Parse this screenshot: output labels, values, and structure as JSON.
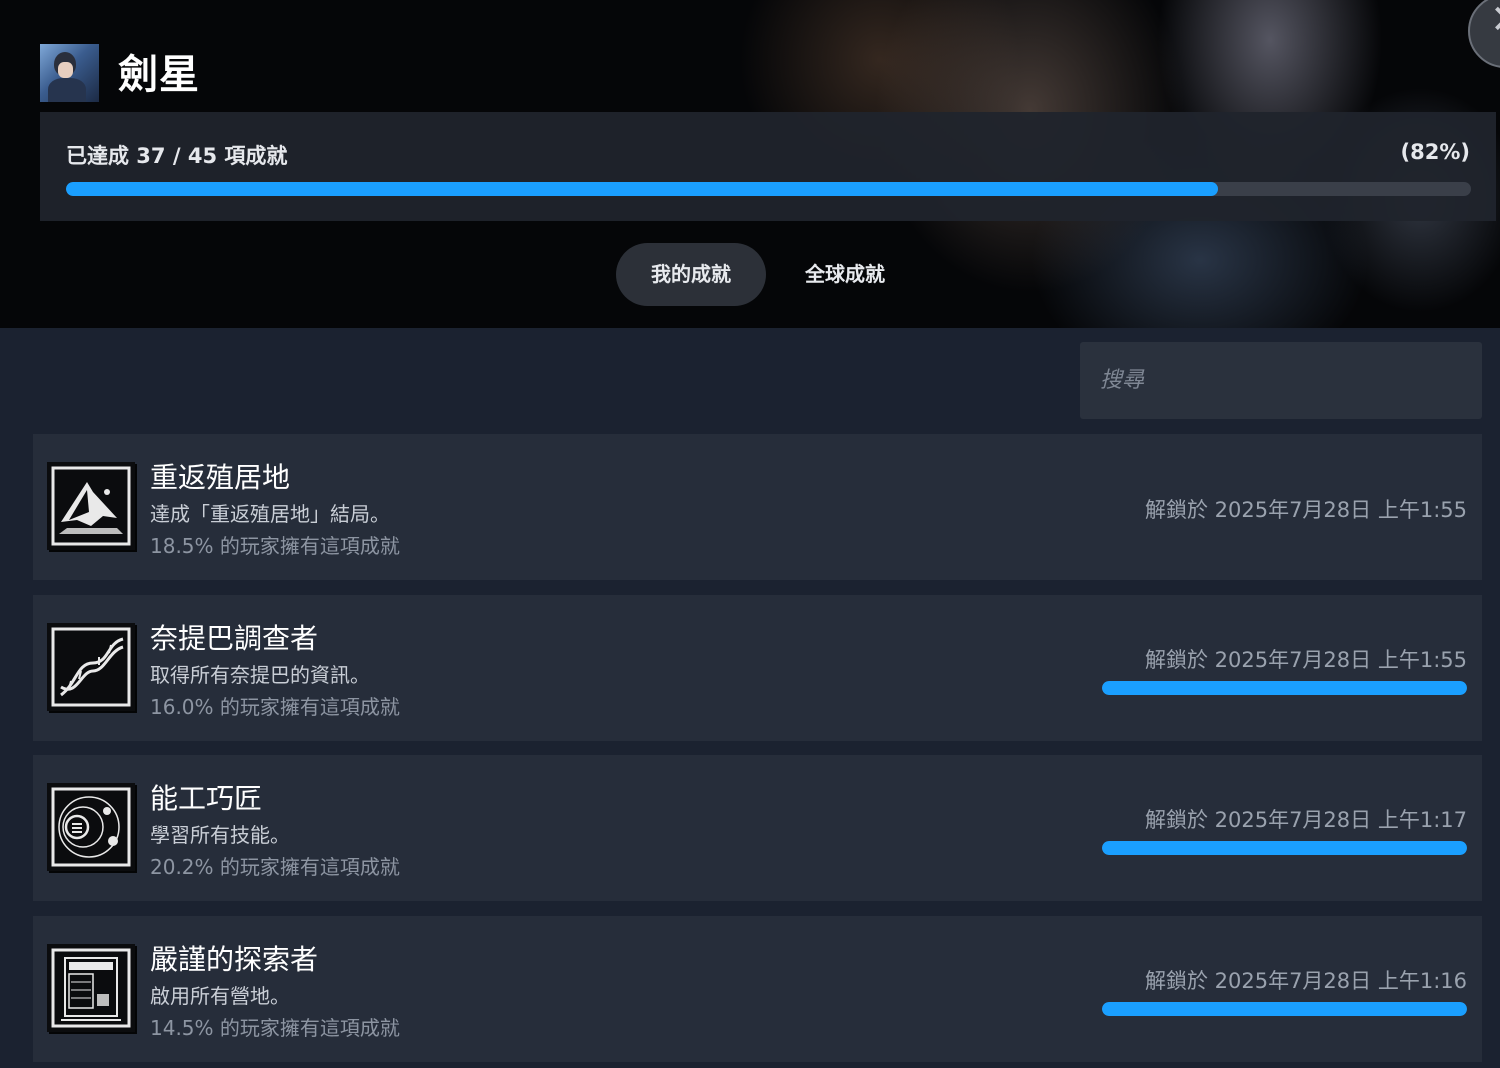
{
  "game": {
    "title": "劍星",
    "icon": "game-cover-icon"
  },
  "progress": {
    "text": "已達成 37 / 45 項成就",
    "percent_text": "(82%)",
    "fraction": 0.82,
    "fill_color": "#1a9fff"
  },
  "tabs": [
    {
      "label": "我的成就",
      "active": true
    },
    {
      "label": "全球成就",
      "active": false
    }
  ],
  "search": {
    "placeholder": "搜尋",
    "value": ""
  },
  "achievements": [
    {
      "name": "重返殖居地",
      "description": "達成「重返殖居地」結局。",
      "global_percent": "18.5% 的玩家擁有這項成就",
      "unlocked": "解鎖於 2025年7月28日 上午1:55",
      "icon": "colony-ship-icon",
      "progress_bar": null
    },
    {
      "name": "奈提巴調查者",
      "description": "取得所有奈提巴的資訊。",
      "global_percent": "16.0% 的玩家擁有這項成就",
      "unlocked": "解鎖於 2025年7月28日 上午1:55",
      "icon": "dna-helix-icon",
      "progress_bar": 1.0
    },
    {
      "name": "能工巧匠",
      "description": "學習所有技能。",
      "global_percent": "20.2% 的玩家擁有這項成就",
      "unlocked": "解鎖於 2025年7月28日 上午1:17",
      "icon": "skill-orbit-icon",
      "progress_bar": 1.0
    },
    {
      "name": "嚴謹的探索者",
      "description": "啟用所有營地。",
      "global_percent": "14.5% 的玩家擁有這項成就",
      "unlocked": "解鎖於 2025年7月28日 上午1:16",
      "icon": "camp-terminal-icon",
      "progress_bar": 1.0
    }
  ]
}
